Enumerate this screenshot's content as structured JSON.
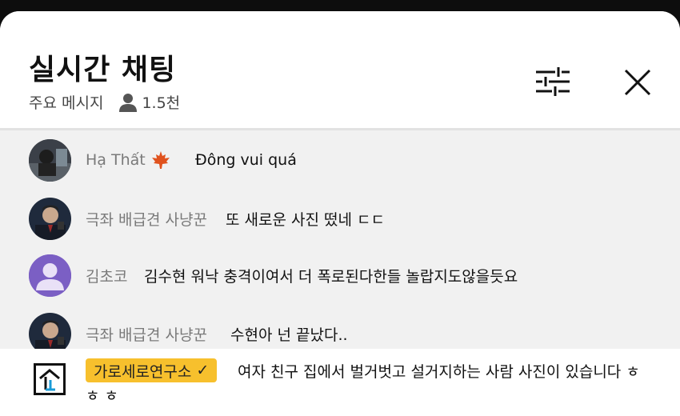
{
  "header": {
    "title": "실시간 채팅",
    "mode": "주요 메시지",
    "viewer_count": "1.5천"
  },
  "messages": [
    {
      "author": "Hạ Thất",
      "text": "Đông vui quá",
      "avatar": "photo",
      "badge_icon": "maple-leaf-icon"
    },
    {
      "author": "극좌 배급견 사냥꾼",
      "text": "또 새로운 사진 떴네 ㄷㄷ",
      "avatar": "photo"
    },
    {
      "author": "김초코",
      "text": "김수현 워낙 충격이여서 더 폭로된다한들 놀랍지도않을듯요",
      "avatar": "default"
    },
    {
      "author": "극좌 배급견 사냥꾼",
      "text": "수현아 넌 끝났다..",
      "avatar": "photo"
    }
  ],
  "pinned": {
    "author": "가로세로연구소",
    "verified_mark": "✓",
    "text": "여자 친구 집에서 벌거벗고 설거지하는 사람 사진이 있습니다 ㅎㅎ ㅎ"
  },
  "colors": {
    "badge_bg": "#f7c02d",
    "default_avatar": "#7b5fc4"
  }
}
